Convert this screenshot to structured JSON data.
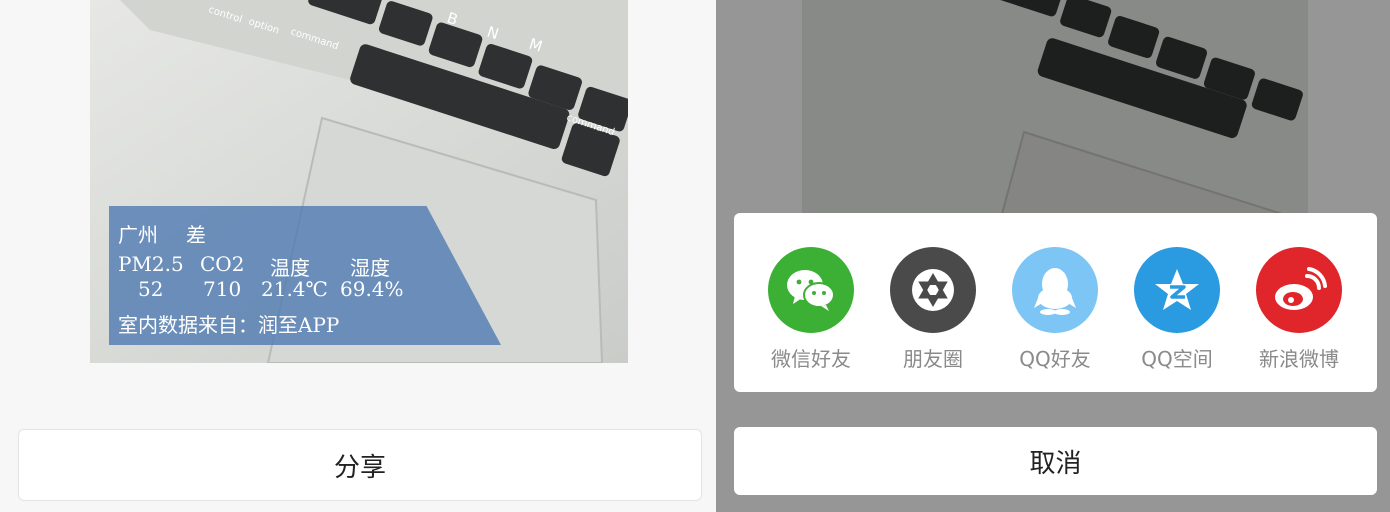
{
  "preview": {
    "city": "广州",
    "quality": "差",
    "labels": {
      "pm25": "PM2.5",
      "co2": "CO2",
      "temp": "温度",
      "humidity": "湿度"
    },
    "values": {
      "pm25": "52",
      "co2": "710",
      "temp": "21.4℃",
      "humidity": "69.4%"
    },
    "source": "室内数据来自：润至APP"
  },
  "keyboard": {
    "keys_row1": [
      "control",
      "option",
      "command"
    ],
    "letters": [
      "B",
      "N",
      "M"
    ],
    "keys_row2": [
      "command"
    ]
  },
  "share_button": {
    "label": "分享"
  },
  "share_sheet": {
    "items": [
      {
        "label": "微信好友",
        "icon": "wechat-icon",
        "color": "#3cb034"
      },
      {
        "label": "朋友圈",
        "icon": "moments-icon",
        "color": "#4a4a4a"
      },
      {
        "label": "QQ好友",
        "icon": "qq-icon",
        "color": "#7cc5f5"
      },
      {
        "label": "QQ空间",
        "icon": "qzone-icon",
        "color": "#2a9be0"
      },
      {
        "label": "新浪微博",
        "icon": "weibo-icon",
        "color": "#e0262a"
      }
    ]
  },
  "cancel_button": {
    "label": "取消"
  }
}
